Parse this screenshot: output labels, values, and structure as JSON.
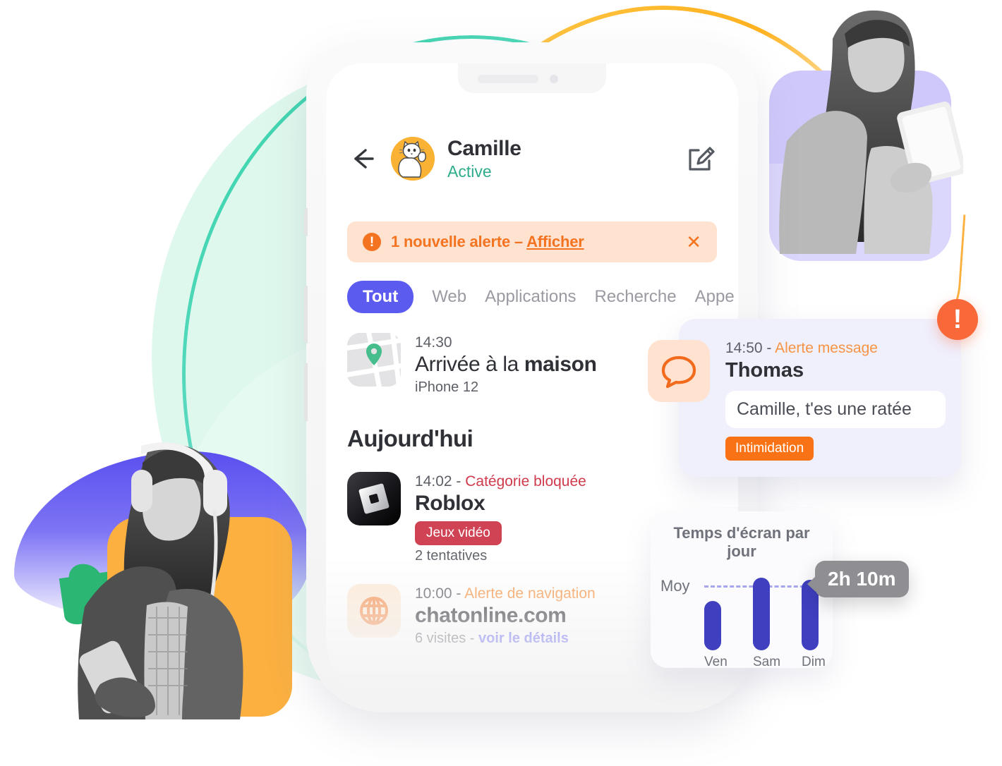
{
  "app": {
    "header": {
      "back_icon": "back-arrow-icon",
      "avatar_icon": "cat-avatar",
      "name": "Camille",
      "status": "Active",
      "edit_icon": "edit-pencil-icon"
    },
    "alert_banner": {
      "icon": "exclamation-icon",
      "text": "1 nouvelle alerte – ",
      "link": "Afficher",
      "close_icon": "close-icon"
    },
    "tabs": [
      {
        "label": "Tout",
        "active": true
      },
      {
        "label": "Web",
        "active": false
      },
      {
        "label": "Applications",
        "active": false
      },
      {
        "label": "Recherche",
        "active": false
      },
      {
        "label": "Appe",
        "active": false
      }
    ],
    "location_event": {
      "icon": "map-pin-icon",
      "time": "14:30",
      "title_light": "Arrivée à la ",
      "title_bold": "maison",
      "device": "iPhone 12"
    },
    "section_title": "Aujourd'hui",
    "events": [
      {
        "icon": "roblox-icon",
        "time": "14:02 - ",
        "kind": "Catégorie bloquée",
        "kind_color": "#cf3b4c",
        "title": "Roblox",
        "chip": "Jeux vidéo",
        "sub": "2 tentatives",
        "sub_link": ""
      },
      {
        "icon": "globe-icon",
        "time": "10:00 - ",
        "kind": "Alerte de navigation",
        "kind_color": "#f79445",
        "title": "chatonline.com",
        "chip": "",
        "sub": "6 visites - ",
        "sub_link": "voir le détails"
      }
    ]
  },
  "message_alert": {
    "icon": "chat-bubble-icon",
    "time": "14:50 - ",
    "kind": "Alerte message",
    "sender": "Thomas",
    "message": "Camille, t'es une ratée",
    "chip": "Intimidation",
    "badge_icon": "alert-exclamation-badge"
  },
  "screen_time": {
    "title": "Temps d'écran par jour",
    "avg_label": "Moy",
    "tooltip": "2h 10m",
    "chart_data": {
      "type": "bar",
      "title": "Temps d'écran par jour",
      "categories": [
        "Ven",
        "Sam",
        "Dim"
      ],
      "values": [
        1.6,
        2.3,
        2.25
      ],
      "unit": "hours",
      "average_line": 2.17,
      "average_label": "2h 10m",
      "ylim": [
        0,
        2.5
      ],
      "grid": false,
      "legend": "none",
      "bar_color": "#3f3fbf"
    }
  },
  "colors": {
    "accent_blue": "#5b5bf0",
    "accent_orange": "#f47321",
    "accent_red": "#cf4354",
    "accent_green": "#2eac8c",
    "bar_purple": "#3f3fbf"
  }
}
